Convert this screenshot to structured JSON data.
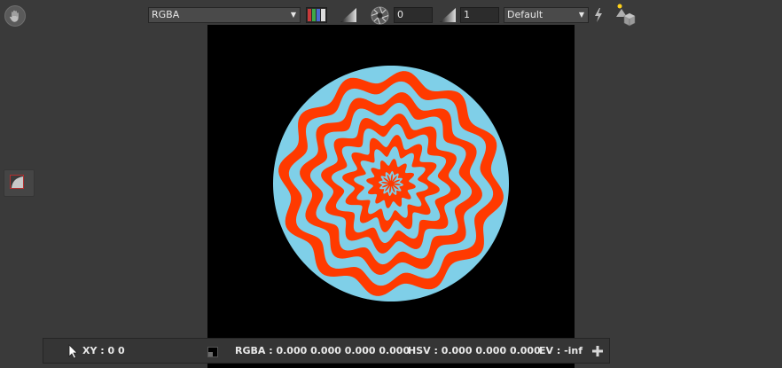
{
  "toolbar": {
    "channel_select": {
      "value": "RGBA"
    },
    "exposure": {
      "value": "0"
    },
    "gamma": {
      "value": "1"
    },
    "view_select": {
      "value": "Default"
    }
  },
  "statusbar": {
    "xy": "XY : 0 0",
    "rgba": "RGBA : 0.000 0.000 0.000 0.000",
    "hsv": "HSV : 0.000 0.000 0.000",
    "ev": "EV : -inf"
  },
  "colors": {
    "stripe_red": "#ff3a00",
    "stripe_blue": "#7fcfe8",
    "viewport_bg": "#000000"
  },
  "icons": {
    "hand": "hand-icon",
    "channels": "rgb-channels-icon",
    "exposure_ramp": "ramp-icon",
    "aperture": "aperture-icon",
    "gamma_ramp": "ramp-icon",
    "lightning": "lightning-icon",
    "shapes": "shapes-icon",
    "side_tool": "curve-tool-icon",
    "cursor": "cursor-icon",
    "swatch": "color-swatch-icon",
    "add": "plus-icon"
  }
}
